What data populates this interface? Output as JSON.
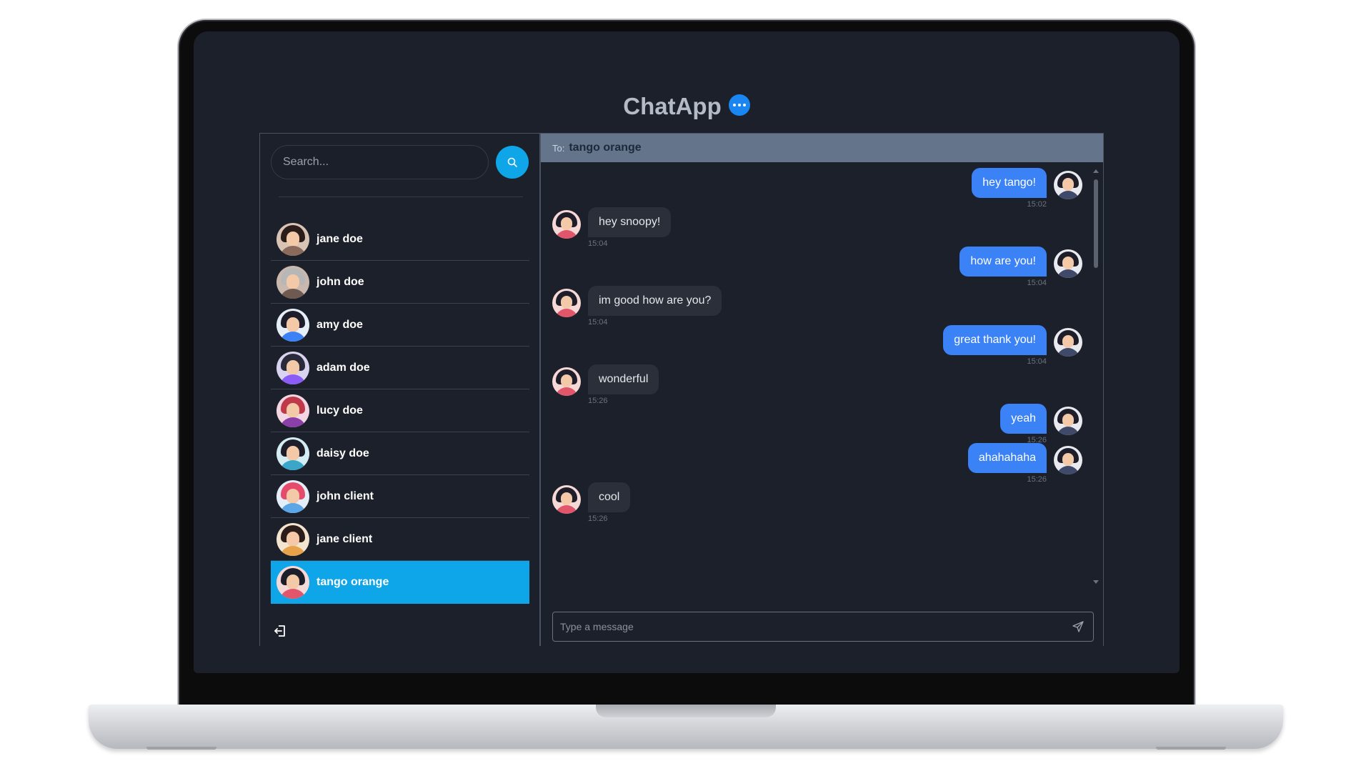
{
  "app": {
    "title": "ChatApp"
  },
  "search": {
    "placeholder": "Search..."
  },
  "contacts": [
    {
      "name": "jane doe",
      "hair": "#2b1d1a",
      "body": "#8a6a5a",
      "bg": "#d9c3b5"
    },
    {
      "name": "john doe",
      "hair": "#b7b7b7",
      "body": "#6e5a50",
      "bg": "#c8b8ad"
    },
    {
      "name": "amy doe",
      "hair": "#1d1d2b",
      "body": "#3b82f6",
      "bg": "#e6eef8"
    },
    {
      "name": "adam doe",
      "hair": "#2a2a3a",
      "body": "#8b5cf6",
      "bg": "#d9d3f2"
    },
    {
      "name": "lucy doe",
      "hair": "#c0394b",
      "body": "#8b3fa8",
      "bg": "#f3d6e3"
    },
    {
      "name": "daisy doe",
      "hair": "#1e1e2a",
      "body": "#3aa6c9",
      "bg": "#d4ecf3"
    },
    {
      "name": "john client",
      "hair": "#e54b6a",
      "body": "#5aa6e6",
      "bg": "#e3eef8"
    },
    {
      "name": "jane client",
      "hair": "#2b1d1a",
      "body": "#e8a24a",
      "bg": "#f3e4d0"
    },
    {
      "name": "tango orange",
      "hair": "#1e1e2a",
      "body": "#e2566b",
      "bg": "#f6d9d6",
      "active": true
    }
  ],
  "chat": {
    "to_label": "To:",
    "recipient": "tango orange",
    "composer_placeholder": "Type a message",
    "messages": [
      {
        "direction": "sent",
        "text": "hey tango!",
        "time": "15:02"
      },
      {
        "direction": "received",
        "text": "hey snoopy!",
        "time": "15:04"
      },
      {
        "direction": "sent",
        "text": "how are you!",
        "time": "15:04"
      },
      {
        "direction": "received",
        "text": "im good how are you?",
        "time": "15:04"
      },
      {
        "direction": "sent",
        "text": "great thank you!",
        "time": "15:04"
      },
      {
        "direction": "received",
        "text": "wonderful",
        "time": "15:26"
      },
      {
        "direction": "sent",
        "text": "yeah",
        "time": "15:26"
      },
      {
        "direction": "sent",
        "text": "ahahahaha",
        "time": "15:26"
      },
      {
        "direction": "received",
        "text": "cool",
        "time": "15:26"
      }
    ]
  },
  "colors": {
    "accent": "#0ea5e9",
    "sent_bubble": "#3b82f6",
    "received_bubble": "#2a2f3a",
    "header_bar": "#64748b",
    "background": "#1c202a"
  },
  "icons": {
    "logo": "chat-bubble-icon",
    "search": "search-icon",
    "logout": "logout-icon",
    "send": "send-icon"
  }
}
